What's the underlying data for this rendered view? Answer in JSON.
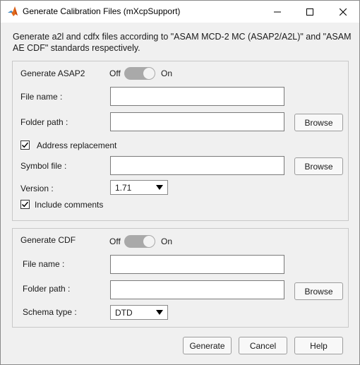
{
  "window": {
    "title": "Generate Calibration Files (mXcpSupport)",
    "description": "Generate a2l and cdfx files according to \"ASAM MCD-2 MC (ASAP2/A2L)\" and \"ASAM AE CDF\" standards respectively."
  },
  "asap2": {
    "heading": "Generate ASAP2",
    "toggle_off": "Off",
    "toggle_on": "On",
    "toggle_state": "On",
    "file_name_label": "File name :",
    "file_name_value": "",
    "folder_path_label": "Folder path :",
    "folder_path_value": "",
    "browse_label": "Browse",
    "address_replacement_label": "Address replacement",
    "address_replacement_checked": true,
    "symbol_file_label": "Symbol file :",
    "symbol_file_value": "",
    "symbol_browse_label": "Browse",
    "version_label": "Version :",
    "version_value": "1.71",
    "include_comments_label": "Include comments",
    "include_comments_checked": true
  },
  "cdf": {
    "heading": "Generate CDF",
    "toggle_off": "Off",
    "toggle_on": "On",
    "toggle_state": "On",
    "file_name_label": "File name :",
    "file_name_value": "",
    "folder_path_label": "Folder path :",
    "folder_path_value": "",
    "browse_label": "Browse",
    "schema_type_label": "Schema type :",
    "schema_type_value": "DTD"
  },
  "footer": {
    "generate_label": "Generate",
    "cancel_label": "Cancel",
    "help_label": "Help"
  },
  "icons": {
    "app": "matlab-logo-icon",
    "minimize": "minimize-icon",
    "maximize": "maximize-icon",
    "close": "close-icon"
  }
}
